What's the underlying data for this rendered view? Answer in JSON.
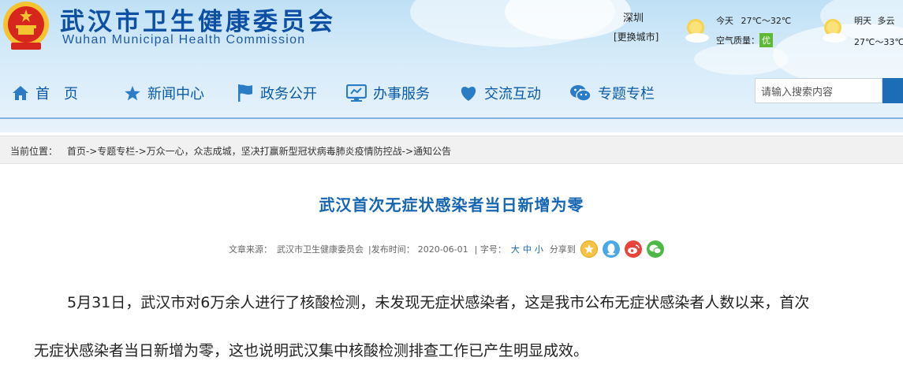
{
  "header": {
    "site_title": "武汉市卫生健康委员会",
    "site_title_en": "Wuhan Municipal Health Commission",
    "emblem": "national-emblem-icon"
  },
  "weather": {
    "city": "深圳",
    "change_city": "[更换城市]",
    "today_label": "今天",
    "today_temp": "27℃～32℃",
    "air_quality_label": "空气质量：",
    "air_quality_value": "优",
    "tomorrow_label": "明天",
    "tomorrow_condition": "多云",
    "tomorrow_temp": "27℃～33℃",
    "icon": "sunny-cloud-icon",
    "air_quality_color": "#5fb833"
  },
  "nav": {
    "items": [
      {
        "label": "首　页",
        "icon": "home-icon"
      },
      {
        "label": "新闻中心",
        "icon": "star-icon"
      },
      {
        "label": "政务公开",
        "icon": "flag-icon"
      },
      {
        "label": "办事服务",
        "icon": "monitor-icon"
      },
      {
        "label": "交流互动",
        "icon": "heart-icon"
      },
      {
        "label": "专题专栏",
        "icon": "wechat-icon"
      }
    ],
    "accent_color": "#0b5aa8"
  },
  "search": {
    "placeholder": "请输入搜索内容"
  },
  "breadcrumb": {
    "prefix": "当前位置：",
    "items": [
      "首页",
      "专题专栏",
      "万众一心，众志成城，坚决打赢新型冠状病毒肺炎疫情防控战",
      "通知公告"
    ],
    "separator": "->"
  },
  "article": {
    "title": "武汉首次无症状感染者当日新增为零",
    "source_label": "文章来源：",
    "source": "武汉市卫生健康委员会",
    "publish_label": "|发布时间：",
    "publish_date": "2020-06-01",
    "font_label": "|  字号：",
    "font_large": "大",
    "font_medium": "中",
    "font_small": "小",
    "share_label": "分享到",
    "share_icons": [
      "qzone-icon",
      "qq-icon",
      "weibo-icon",
      "wechat-icon"
    ],
    "title_color": "#1566b2",
    "para1_line1": "5月31日，武汉市对6万余人进行了核酸检测，未发现无症状感染者，这是我市公布无症状感染者人数以来，首次",
    "para1_line2": "无症状感染者当日新增为零，这也说明武汉集中核酸检测排查工作已产生明显成效。"
  }
}
